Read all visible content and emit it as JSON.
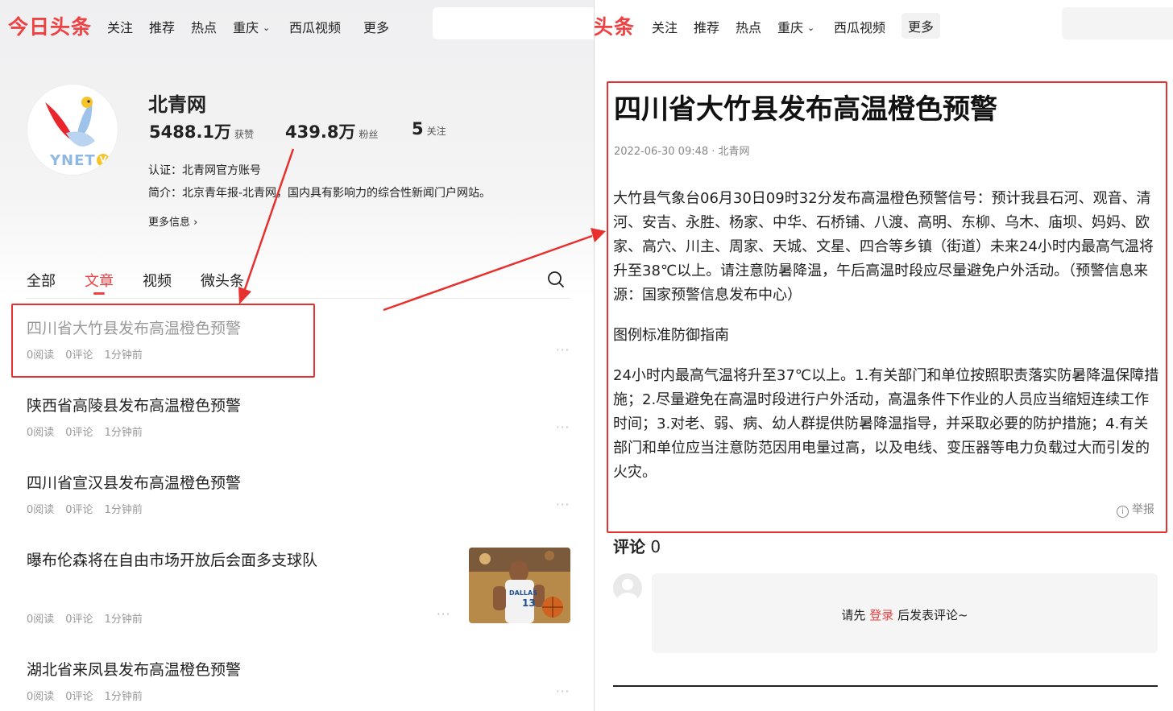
{
  "left": {
    "header": {
      "logo": "今日头条",
      "nav": [
        "关注",
        "推荐",
        "热点",
        "重庆",
        "西瓜视频",
        "更多"
      ]
    },
    "profile": {
      "avatar_text": "YNET",
      "avatar_badge": "V",
      "name": "北青网",
      "likes_num": "5488.1万",
      "likes_label": "获赞",
      "fans_num": "439.8万",
      "fans_label": "粉丝",
      "follow_num": "5",
      "follow_label": "关注",
      "cert": "认证：北青网官方账号",
      "intro": "简介：北京青年报-北青网，国内具有影响力的综合性新闻门户网站。",
      "more": "更多信息 ›"
    },
    "tabs": [
      "全部",
      "文章",
      "视频",
      "微头条"
    ],
    "articles": [
      {
        "title": "四川省大竹县发布高温橙色预警",
        "reads": "0阅读",
        "comments": "0评论",
        "time": "1分钟前"
      },
      {
        "title": "陕西省高陵县发布高温橙色预警",
        "reads": "0阅读",
        "comments": "0评论",
        "time": "1分钟前"
      },
      {
        "title": "四川省宣汉县发布高温橙色预警",
        "reads": "0阅读",
        "comments": "0评论",
        "time": "1分钟前"
      },
      {
        "title": "曝布伦森将在自由市场开放后会面多支球队",
        "reads": "0阅读",
        "comments": "0评论",
        "time": "1分钟前"
      },
      {
        "title": "湖北省来凤县发布高温橙色预警",
        "reads": "0阅读",
        "comments": "0评论",
        "time": "1分钟前"
      }
    ],
    "thumb_text": "DALLAS",
    "thumb_number": "13"
  },
  "right": {
    "header": {
      "logo": "头条",
      "nav": [
        "关注",
        "推荐",
        "热点",
        "重庆",
        "西瓜视频",
        "更多"
      ]
    },
    "article": {
      "title": "四川省大竹县发布高温橙色预警",
      "meta": "2022-06-30 09:48 · 北青网",
      "para1": "大竹县气象台06月30日09时32分发布高温橙色预警信号：预计我县石河、观音、清河、安吉、永胜、杨家、中华、石桥铺、八渡、高明、东柳、乌木、庙坝、妈妈、欧家、高穴、川主、周家、天城、文星、四合等乡镇（街道）未来24小时内最高气温将升至38℃以上。请注意防暑降温，午后高温时段应尽量避免户外活动。（预警信息来源：国家预警信息发布中心）",
      "para2": "图例标准防御指南",
      "para3": "24小时内最高气温将升至37℃以上。1.有关部门和单位按照职责落实防暑降温保障措施；2.尽量避免在高温时段进行户外活动，高温条件下作业的人员应当缩短连续工作时间；3.对老、弱、病、幼人群提供防暑降温指导，并采取必要的防护措施；4.有关部门和单位应当注意防范因用电量过高，以及电线、变压器等电力负载过大而引发的火灾。",
      "report": "举报"
    },
    "comments": {
      "label": "评论",
      "count": "0",
      "prompt_before": "请先",
      "prompt_login": "登录",
      "prompt_after": "后发表评论~"
    }
  },
  "colors": {
    "brand_red": "#f04142",
    "annotation_red": "#e8302e"
  }
}
